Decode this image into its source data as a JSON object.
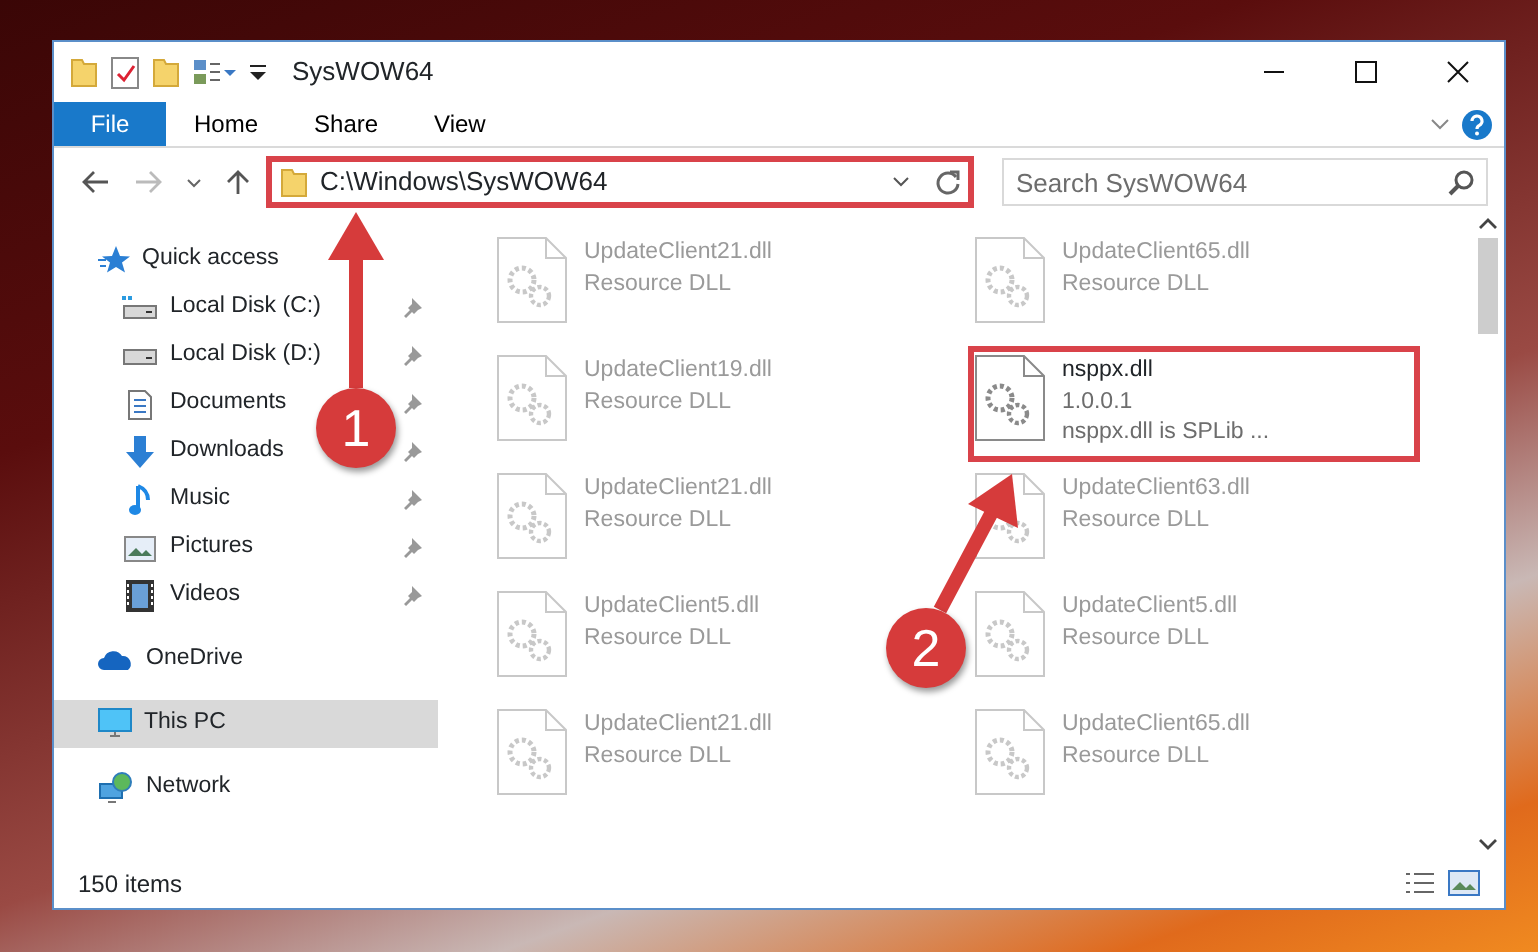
{
  "window": {
    "title": "SysWOW64"
  },
  "ribbon_tabs": [
    {
      "label": "File",
      "kind": "menu"
    },
    {
      "label": "Home",
      "kind": "tab"
    },
    {
      "label": "Share",
      "kind": "tab"
    },
    {
      "label": "View",
      "kind": "tab"
    }
  ],
  "address": {
    "path": "C:\\Windows\\SysWOW64"
  },
  "search": {
    "placeholder": "Search SysWOW64"
  },
  "navigation": [
    {
      "label": "Quick access",
      "selected": false,
      "children": [
        {
          "label": "Local Disk (C:)",
          "pinned": true
        },
        {
          "label": "Local Disk (D:)",
          "pinned": true
        },
        {
          "label": "Documents",
          "pinned": true
        },
        {
          "label": "Downloads",
          "pinned": true
        },
        {
          "label": "Music",
          "pinned": true
        },
        {
          "label": "Pictures",
          "pinned": true
        },
        {
          "label": "Videos",
          "pinned": true
        }
      ]
    },
    {
      "label": "OneDrive",
      "selected": false
    },
    {
      "label": "This PC",
      "selected": true
    },
    {
      "label": "Network",
      "selected": false
    }
  ],
  "files": [
    {
      "name": "UpdateClient21.dll",
      "lines": [
        "Resource DLL"
      ],
      "highlighted": false
    },
    {
      "name": "UpdateClient65.dll",
      "lines": [
        "Resource DLL"
      ],
      "highlighted": false
    },
    {
      "name": "UpdateClient19.dll",
      "lines": [
        "Resource DLL"
      ],
      "highlighted": false
    },
    {
      "name": "nsppx.dll",
      "lines": [
        "1.0.0.1",
        "nsppx.dll is SPLib ..."
      ],
      "highlighted": true
    },
    {
      "name": "UpdateClient21.dll",
      "lines": [
        "Resource DLL"
      ],
      "highlighted": false
    },
    {
      "name": "UpdateClient63.dll",
      "lines": [
        "Resource DLL"
      ],
      "highlighted": false
    },
    {
      "name": "UpdateClient5.dll",
      "lines": [
        "Resource DLL"
      ],
      "highlighted": false
    },
    {
      "name": "UpdateClient5.dll",
      "lines": [
        "Resource DLL"
      ],
      "highlighted": false
    },
    {
      "name": "UpdateClient21.dll",
      "lines": [
        "Resource DLL"
      ],
      "highlighted": false
    },
    {
      "name": "UpdateClient65.dll",
      "lines": [
        "Resource DLL"
      ],
      "highlighted": false
    }
  ],
  "status_bar": {
    "count": "150 items"
  },
  "annotations": [
    {
      "number": "1"
    },
    {
      "number": "2"
    }
  ]
}
